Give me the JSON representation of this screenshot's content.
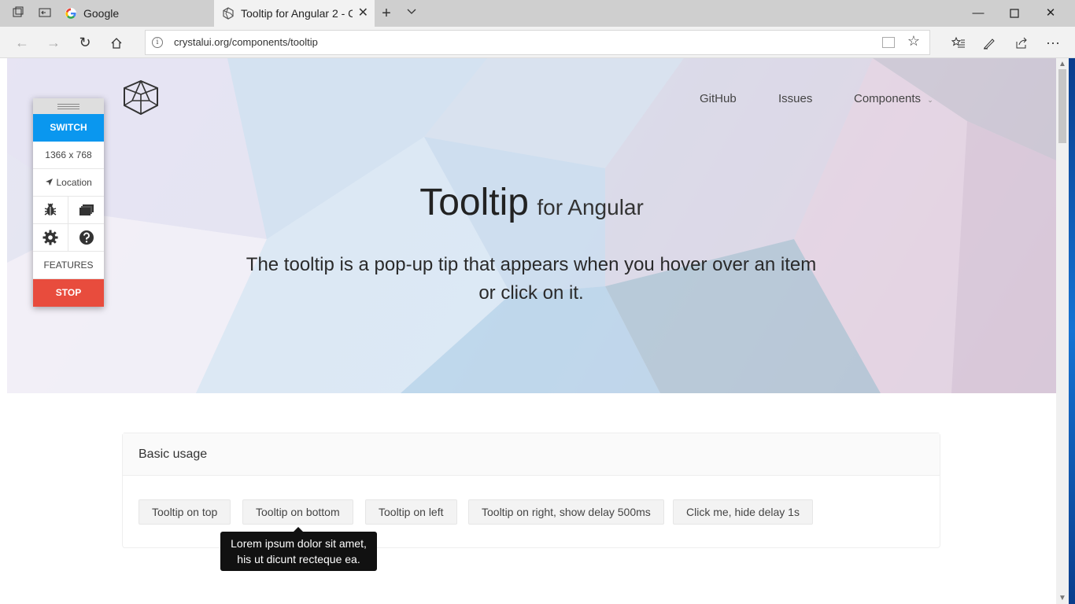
{
  "browser": {
    "tabs": [
      {
        "title": "Google",
        "active": false
      },
      {
        "title": "Tooltip for Angular 2 - Cr",
        "active": true
      }
    ],
    "address": "crystalui.org/components/tooltip"
  },
  "site": {
    "nav": [
      "GitHub",
      "Issues",
      "Components"
    ],
    "hero": {
      "title": "Tooltip",
      "subtitle": "for Angular",
      "description": "The tooltip is a pop-up tip that appears when you hover over an item or click on it."
    },
    "card": {
      "title": "Basic usage",
      "buttons": [
        "Tooltip on top",
        "Tooltip on bottom",
        "Tooltip on left",
        "Tooltip on right, show delay 500ms",
        "Click me, hide delay 1s"
      ]
    },
    "tooltip": {
      "line1": "Lorem ipsum dolor sit amet,",
      "line2": "his ut dicunt recteque ea."
    }
  },
  "switcher": {
    "switch": "SWITCH",
    "resolution": "1366 x 768",
    "location": "Location",
    "features": "FEATURES",
    "stop": "STOP"
  },
  "colors": {
    "switch": "#0a97ef",
    "stop": "#e84c3d",
    "tooltip_bg": "#111111"
  }
}
